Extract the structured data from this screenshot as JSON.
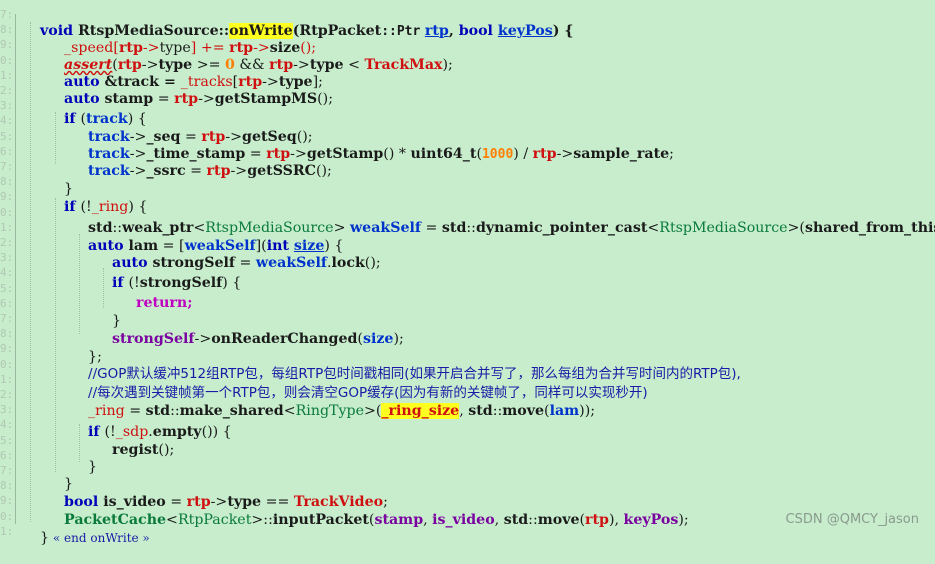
{
  "gutter_numbers": [
    "7",
    "8",
    "9",
    "0",
    "1",
    "2",
    "3",
    "4",
    "5",
    "6",
    "7",
    "8",
    "9",
    "0",
    "1",
    "2",
    "3",
    "4",
    "5",
    "6",
    "7",
    "8",
    "9",
    "0",
    "1",
    "2",
    "3",
    "4",
    "5",
    "6",
    "7",
    "8",
    "9",
    "0",
    "1"
  ],
  "code": {
    "l1_void": "void ",
    "l1_class": "RtspMediaSource",
    "l1_sep": "::",
    "l1_fn": "onWrite",
    "l1_open": "(",
    "l1_ptype": "RtpPacket",
    "l1_ptr": "::Ptr",
    "l1_sp": " ",
    "l1_rtp": "rtp",
    "l1_comma": ", ",
    "l1_bool": "bool ",
    "l1_keypos": "keyPos",
    "l1_close": ") {",
    "l2": "_speed[rtp->type] += rtp->size();",
    "l3_assert": "assert",
    "l3_rest_a": "(rtp->type >= ",
    "l3_zero": "0",
    "l3_rest_b": " && rtp->type < ",
    "l3_max": "TrackMax",
    "l3_end": ");",
    "l4": "auto &track = _tracks[rtp->type];",
    "l5": "auto stamp = rtp->getStampMS();",
    "l6": "if (track) {",
    "l7": "track->_seq = rtp->getSeq();",
    "l8_a": "track->_time_stamp = rtp->getStamp() * uint64_t(",
    "l8_num": "1000",
    "l8_b": ") / rtp->sample_rate;",
    "l9": "track->_ssrc = rtp->getSSRC();",
    "l10": "}",
    "l11": "if (!_ring) {",
    "l12_a": "std::weak_ptr<",
    "l12_t": "RtspMediaSource",
    "l12_b": "> weakSelf = std::dynamic_pointer_cast<",
    "l12_t2": "RtspMediaSource",
    "l12_c": ">(shared_from_this());",
    "l13_a": "auto lam = [weakSelf](int ",
    "l13_size": "size",
    "l13_b": ") {",
    "l14": "auto strongSelf = weakSelf.lock();",
    "l15": "if (!strongSelf) {",
    "l16": "return;",
    "l17": "}",
    "l18": "strongSelf->onReaderChanged(size);",
    "l19": "};",
    "l20": "//GOP默认缓冲512组RTP包，每组RTP包时间戳相同(如果开启合并写了，那么每组为合并写时间内的RTP包),",
    "l21": "//每次遇到关键帧第一个RTP包，则会清空GOP缓存(因为有新的关键帧了，同样可以实现秒开)",
    "l22_a": "_ring = std::make_shared<",
    "l22_t": "RingType",
    "l22_b": ">(",
    "l22_hl": "_ring_size",
    "l22_c": ", std::move(lam));",
    "l23": "if (!_sdp.empty()) {",
    "l24": "regist();",
    "l25": "}",
    "l26": "}",
    "l27_a": "bool is_video = rtp->type == ",
    "l27_t": "TrackVideo",
    "l27_b": ";",
    "l28_a": "PacketCache<",
    "l28_t": "RtpPacket",
    "l28_b": ">::inputPacket(stamp, is_video, std::move(rtp), keyPos);",
    "l29": "}",
    "l29_end": " « end onWrite »"
  },
  "watermark": "CSDN @QMCY_jason"
}
